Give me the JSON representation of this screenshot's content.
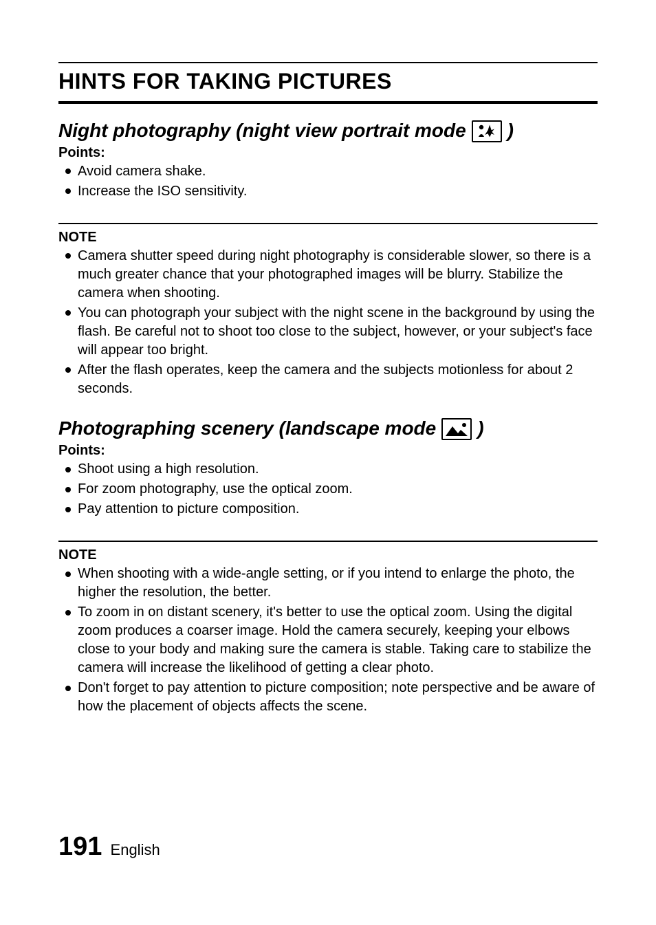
{
  "page": {
    "title": "HINTS FOR TAKING PICTURES",
    "footer_number": "191",
    "footer_lang": "English"
  },
  "section1": {
    "heading_pre": "Night photography (night view portrait mode",
    "heading_post": ")",
    "points_label": "Points:",
    "points": [
      "Avoid camera shake.",
      "Increase the ISO sensitivity."
    ],
    "note_label": "NOTE",
    "notes": [
      "Camera shutter speed during night photography is considerable slower, so there is a much greater chance that your photographed images will be blurry. Stabilize the camera when shooting.",
      "You can photograph your subject with the night scene in the background by using the flash. Be careful not to shoot too close to the subject, however, or your subject's face will appear too bright.",
      "After the flash operates, keep the camera and the subjects motionless for about 2 seconds."
    ]
  },
  "section2": {
    "heading_pre": "Photographing scenery (landscape mode",
    "heading_post": ")",
    "points_label": "Points:",
    "points": [
      "Shoot using a high resolution.",
      "For zoom photography, use the optical zoom.",
      "Pay attention to picture composition."
    ],
    "note_label": "NOTE",
    "notes": [
      "When shooting with a wide-angle setting, or if you intend to enlarge the photo, the higher the resolution, the better.",
      "To zoom in on distant scenery, it's better to use the optical zoom. Using the digital zoom produces a coarser image. Hold the camera securely, keeping your elbows close to your body and making sure the camera is stable. Taking care to stabilize the camera will increase the likelihood of getting a clear photo.",
      "Don't forget to pay attention to picture composition; note perspective and be aware of how the placement of objects affects the scene."
    ]
  }
}
